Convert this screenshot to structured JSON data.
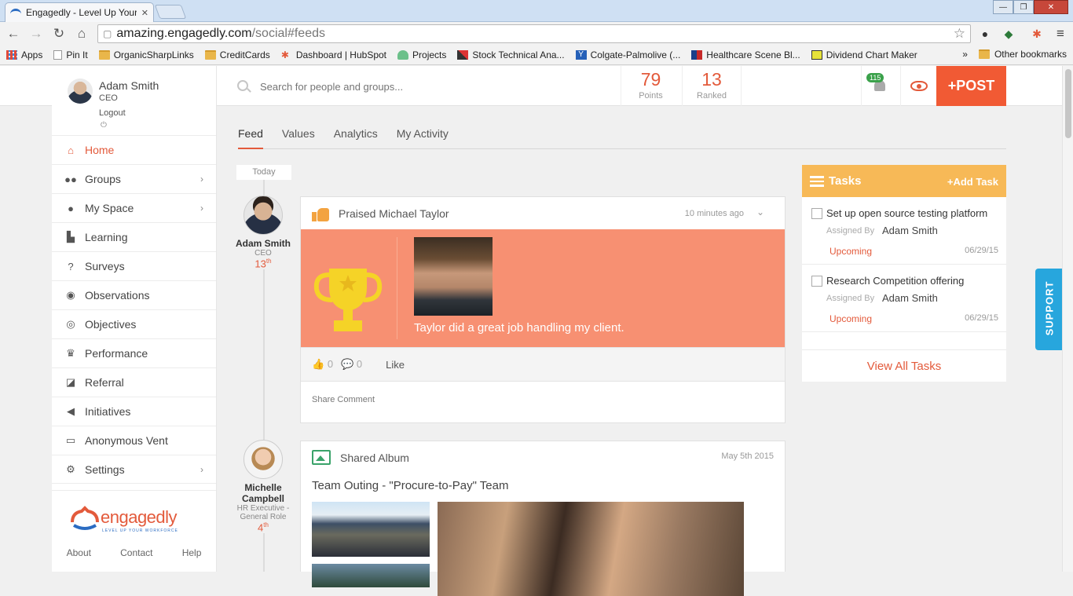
{
  "browser": {
    "tab_title": "Engagedly - Level Up Your",
    "url_host": "amazing.engagedly.com",
    "url_path": "/social#feeds",
    "bookmarks": [
      "Apps",
      "Pin It",
      "OrganicSharpLinks",
      "CreditCards",
      "Dashboard | HubSpot",
      "Projects",
      "Stock Technical Ana...",
      "Colgate-Palmolive (...",
      "Healthcare Scene Bl...",
      "Dividend Chart Maker"
    ],
    "more": "»",
    "other_bookmarks": "Other bookmarks"
  },
  "profile": {
    "name": "Adam Smith",
    "role": "CEO",
    "logout": "Logout"
  },
  "search": {
    "placeholder": "Search for people and groups..."
  },
  "stats": {
    "points": "79",
    "points_label": "Points",
    "ranked": "13",
    "ranked_label": "Ranked"
  },
  "notifications": {
    "count": "115"
  },
  "post_button": "+POST",
  "sidebar": {
    "items": [
      {
        "label": "Home",
        "icon": "home-icon"
      },
      {
        "label": "Groups",
        "icon": "groups-icon"
      },
      {
        "label": "My Space",
        "icon": "user-icon"
      },
      {
        "label": "Learning",
        "icon": "puzzle-icon"
      },
      {
        "label": "Surveys",
        "icon": "question-icon"
      },
      {
        "label": "Observations",
        "icon": "eye-icon"
      },
      {
        "label": "Objectives",
        "icon": "target-icon"
      },
      {
        "label": "Performance",
        "icon": "trophy-icon"
      },
      {
        "label": "Referral",
        "icon": "external-link-icon"
      },
      {
        "label": "Initiatives",
        "icon": "bullhorn-icon"
      },
      {
        "label": "Anonymous Vent",
        "icon": "inbox-icon"
      },
      {
        "label": "Settings",
        "icon": "gear-icon"
      }
    ],
    "logo_text": "engagedly",
    "logo_tagline": "LEVEL UP YOUR WORKFORCE",
    "footer": {
      "about": "About",
      "contact": "Contact",
      "help": "Help"
    }
  },
  "tabs": [
    "Feed",
    "Values",
    "Analytics",
    "My Activity"
  ],
  "feed": {
    "day_label": "Today",
    "posts": [
      {
        "author": "Adam Smith",
        "role": "CEO",
        "rank": "13",
        "rank_suffix": "th",
        "action": "Praised Michael Taylor",
        "time": "10 minutes ago",
        "message": "Taylor did a great job handling my client.",
        "likes": "0",
        "comments": "0",
        "like_label": "Like",
        "share_comment": "Share Comment"
      },
      {
        "author_first": "Michelle",
        "author_last": "Campbell",
        "role_line1": "HR Executive -",
        "role_line2": "General Role",
        "rank": "4",
        "rank_suffix": "th",
        "action": "Shared Album",
        "time": "May 5th 2015",
        "album_title": "Team Outing - \"Procure-to-Pay\" Team"
      }
    ]
  },
  "tasks": {
    "title": "Tasks",
    "add_label": "+Add Task",
    "items": [
      {
        "title": "Set up open source testing platform",
        "assigned_label": "Assigned By",
        "assignee": "Adam Smith",
        "status": "Upcoming",
        "date": "06/29/15"
      },
      {
        "title": "Research Competition offering",
        "assigned_label": "Assigned By",
        "assignee": "Adam Smith",
        "status": "Upcoming",
        "date": "06/29/15"
      }
    ],
    "view_all": "View All Tasks"
  },
  "support_label": "SUPPORT",
  "colors": {
    "accent": "#e35a3b",
    "praise_bg": "#f79072",
    "tasks_header": "#f7b957",
    "support": "#27a6dd"
  }
}
